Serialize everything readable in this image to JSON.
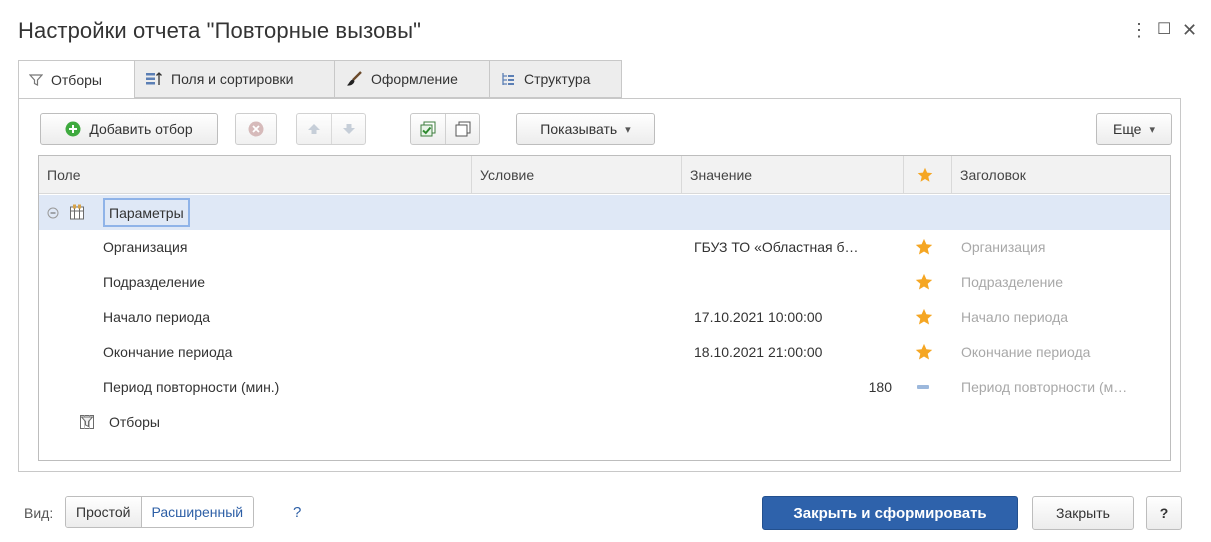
{
  "window": {
    "title": "Настройки отчета \"Повторные вызовы\"",
    "more_glyph": "⋮",
    "maximize_glyph": "☐",
    "close_glyph": "✕"
  },
  "tabs": [
    {
      "label": "Отборы",
      "icon": "filter-icon",
      "active": true
    },
    {
      "label": "Поля и сортировки",
      "icon": "fields-sort-icon",
      "active": false
    },
    {
      "label": "Оформление",
      "icon": "brush-icon",
      "active": false
    },
    {
      "label": "Структура",
      "icon": "structure-icon",
      "active": false
    }
  ],
  "toolbar": {
    "add_filter_label": "Добавить отбор",
    "show_label": "Показывать",
    "more_label": "Еще",
    "dropdown_glyph": "▾"
  },
  "table": {
    "columns": [
      "Поле",
      "Условие",
      "Значение",
      "Заголовок"
    ],
    "group_label": "Параметры",
    "rows": [
      {
        "field": "Организация",
        "value": "ГБУЗ ТО «Областная б…",
        "use": "star",
        "title": "Организация"
      },
      {
        "field": "Подразделение",
        "value": "",
        "use": "star",
        "title": "Подразделение"
      },
      {
        "field": "Начало периода",
        "value": "17.10.2021 10:00:00",
        "use": "star",
        "title": "Начало периода"
      },
      {
        "field": "Окончание периода",
        "value": "18.10.2021 21:00:00",
        "use": "star",
        "title": "Окончание периода"
      },
      {
        "field": "Период повторности (мин.)",
        "value": "180",
        "use": "dash",
        "title": "Период повторности (м…"
      }
    ],
    "filters_label": "Отборы"
  },
  "footer": {
    "view_label": "Вид:",
    "simple_label": "Простой",
    "extended_label": "Расширенный",
    "help_link": "?",
    "close_generate_label": "Закрыть и сформировать",
    "close_label": "Закрыть",
    "help_button": "?"
  },
  "colors": {
    "accent": "#2e62ab",
    "selection": "#dfe8f6",
    "star": "#f5a623",
    "add_icon": "#3faa3f",
    "link": "#2d5fa6"
  }
}
